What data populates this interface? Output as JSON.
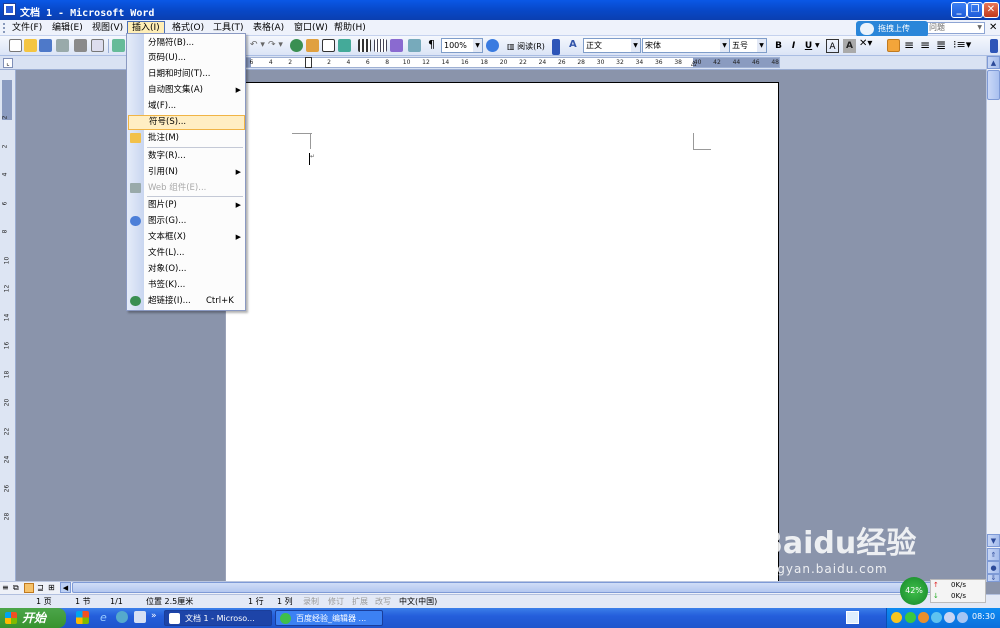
{
  "window": {
    "title": "文档 1 - Microsoft Word",
    "min": "_",
    "max": "❐",
    "close": "✕"
  },
  "menubar": {
    "items": [
      "文件(F)",
      "编辑(E)",
      "视图(V)",
      "插入(I)",
      "格式(O)",
      "工具(T)",
      "表格(A)",
      "窗口(W)",
      "帮助(H)"
    ],
    "active_index": 3,
    "ask_placeholder": "问题",
    "upload_label": "拖拽上传"
  },
  "toolbar": {
    "zoom": "100%",
    "read_label": "阅读(R)",
    "style": "正文",
    "font": "宋体",
    "size": "五号",
    "bold": "B",
    "italic": "I",
    "underline": "U",
    "font_color": "A",
    "highlight": "A"
  },
  "ruler": {
    "ticks": [
      "8",
      "6",
      "4",
      "2",
      "",
      "2",
      "4",
      "6",
      "8",
      "10",
      "12",
      "14",
      "16",
      "18",
      "20",
      "22",
      "24",
      "26",
      "28",
      "30",
      "32",
      "34",
      "36",
      "38",
      "40",
      "42",
      "44",
      "46",
      "48"
    ],
    "vticks": [
      "2",
      "2",
      "4",
      "6",
      "8",
      "10",
      "12",
      "14",
      "16",
      "18",
      "20",
      "22",
      "24",
      "26",
      "28"
    ]
  },
  "insert_menu": {
    "items": [
      {
        "label": "分隔符(B)...",
        "sub": false
      },
      {
        "label": "页码(U)...",
        "sub": false
      },
      {
        "label": "日期和时间(T)...",
        "sub": false
      },
      {
        "label": "自动图文集(A)",
        "sub": true
      },
      {
        "label": "域(F)...",
        "sub": false
      },
      {
        "label": "符号(S)...",
        "sub": false,
        "highlighted": true
      },
      {
        "label": "批注(M)",
        "sub": false
      },
      {
        "label": "数字(R)...",
        "sub": false
      },
      {
        "label": "引用(N)",
        "sub": true
      },
      {
        "label": "Web 组件(E)...",
        "sub": false,
        "disabled": true
      },
      {
        "label": "图片(P)",
        "sub": true
      },
      {
        "label": "图示(G)...",
        "sub": false
      },
      {
        "label": "文本框(X)",
        "sub": true
      },
      {
        "label": "文件(L)...",
        "sub": false
      },
      {
        "label": "对象(O)...",
        "sub": false
      },
      {
        "label": "书签(K)...",
        "sub": false
      },
      {
        "label": "超链接(I)...",
        "sub": false,
        "shortcut": "Ctrl+K"
      }
    ]
  },
  "statusbar": {
    "page": "1 页",
    "section": "1 节",
    "pages": "1/1",
    "position": "位置 2.5厘米",
    "line": "1 行",
    "column": "1 列",
    "rec": "录制",
    "trk": "修订",
    "ext": "扩展",
    "ovr": "改写",
    "lang": "中文(中国)"
  },
  "taskbar": {
    "start": "开始",
    "tasks": [
      "文档 1 - Microso...",
      "百度经验_编辑器 ..."
    ],
    "clock": "08:30"
  },
  "network": {
    "percent": "42%",
    "up": "0K/s",
    "down": "0K/s"
  },
  "watermark": {
    "logo": "Baidu经验",
    "url": "jingyan.baidu.com"
  },
  "colors": {
    "titlebar": "#0848c8",
    "menu_highlight": "#ffeec3",
    "document_bg": "#8a94ab",
    "taskbar": "#245edb",
    "start_button": "#37932e"
  }
}
